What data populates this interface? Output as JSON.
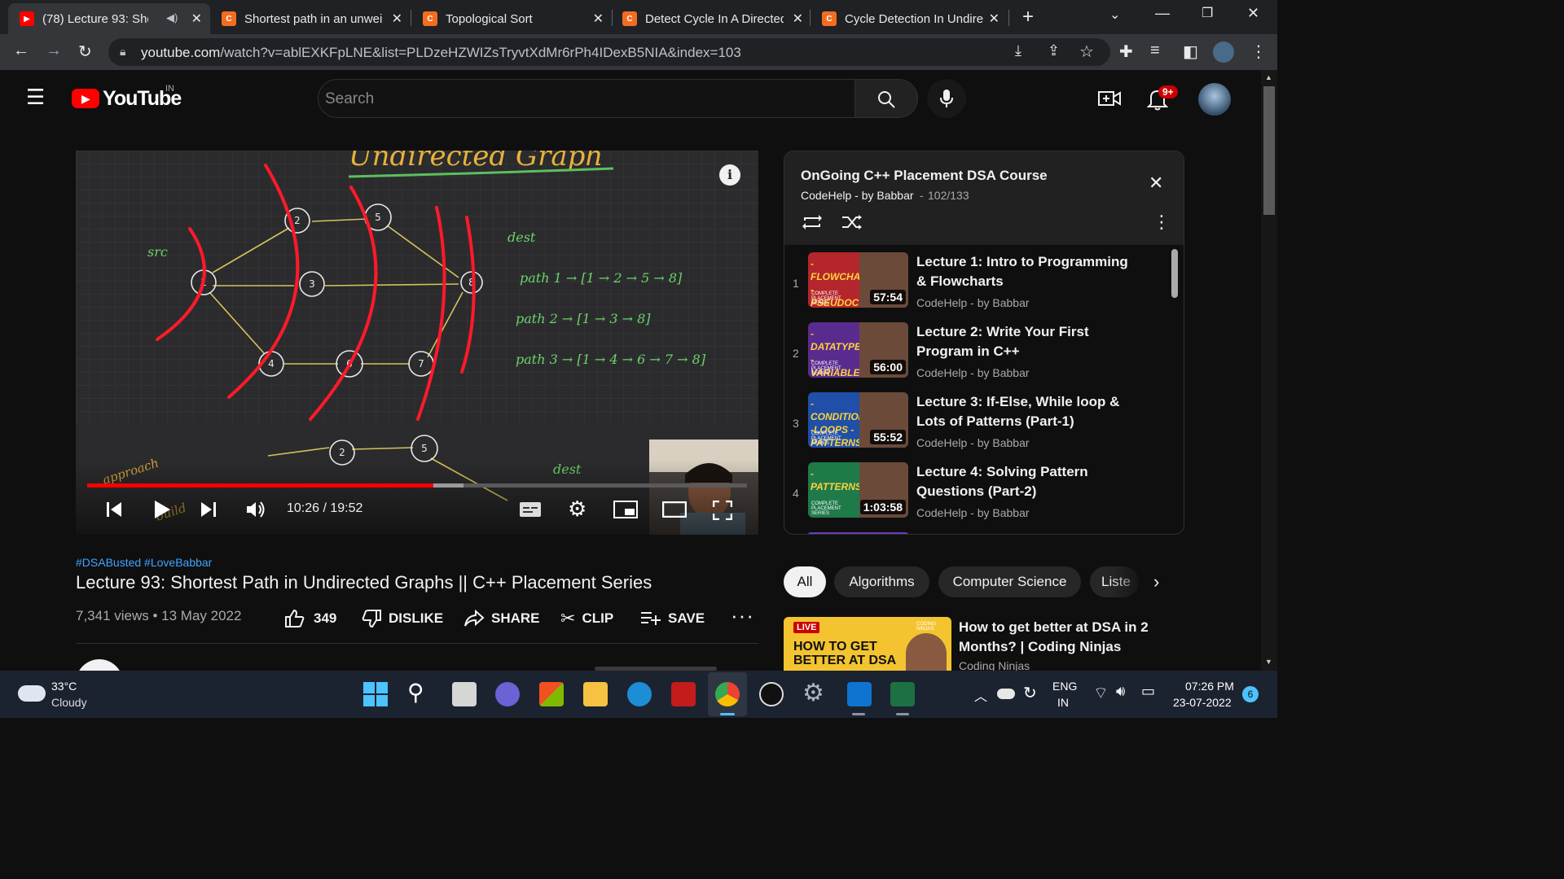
{
  "browser": {
    "tabs": [
      {
        "title": "(78) Lecture 93: Short",
        "favicon": "youtube-favicon"
      },
      {
        "title": "Shortest path in an unwei",
        "favicon": "codestudio-favicon"
      },
      {
        "title": "Topological Sort",
        "favicon": "codestudio-favicon"
      },
      {
        "title": "Detect Cycle In A Directed",
        "favicon": "codestudio-favicon"
      },
      {
        "title": "Cycle Detection In Undire",
        "favicon": "codestudio-favicon"
      }
    ],
    "url_host": "youtube.com",
    "url_rest": "/watch?v=ablEXKFpLNE&list=PLDzeHZWIZsTryvtXdMr6rPh4IDexB5NIA&index=103"
  },
  "youtube": {
    "logo_text": "YouTube",
    "region": "IN",
    "search_placeholder": "Search",
    "notification_count": "9+"
  },
  "player": {
    "time_display": "10:26 / 19:52",
    "played_fraction": 0.525,
    "loaded_fraction": 0.57,
    "board_texts": {
      "top_title": "Undirected Graph",
      "src": "src",
      "dest": "dest",
      "path1": "path 1 →  [1 → 2 → 5 → 8]",
      "path2": "path 2 →  [1 → 3 → 8]",
      "path3": "path 3 →  [1 → 4 → 6 → 7 → 8]",
      "approach": "approach",
      "build": "build",
      "node_labels": [
        "2",
        "5",
        "1",
        "3",
        "8",
        "4",
        "6",
        "7"
      ]
    }
  },
  "video": {
    "hashtags": "#DSABusted #LoveBabbar",
    "title": "Lecture 93: Shortest Path in Undirected Graphs || C++ Placement Series",
    "views_date": "7,341 views • 13 May 2022",
    "actions": {
      "like_count": "349",
      "dislike": "DISLIKE",
      "share": "SHARE",
      "clip": "CLIP",
      "save": "SAVE"
    }
  },
  "playlist": {
    "title": "OnGoing C++ Placement DSA Course",
    "channel": "CodeHelp - by Babbar",
    "position": "102/133",
    "items": [
      {
        "index": "1",
        "title": "Lecture 1: Intro to Programming & Flowcharts",
        "channel": "CodeHelp - by Babbar",
        "duration": "57:54",
        "thumb_text": "-FLOWCHART -PSEUDOCODE",
        "thumb_badge": "COMPLETE PLACEMENT SERIES",
        "color": "#b5262c"
      },
      {
        "index": "2",
        "title": "Lecture 2: Write Your First Program in C++",
        "channel": "CodeHelp - by Babbar",
        "duration": "56:00",
        "thumb_text": "-DATATYPE -VARIABLE -OPERATOR",
        "thumb_badge": "COMPLETE PLACEMENT SERIES",
        "color": "#5a2b8f"
      },
      {
        "index": "3",
        "title": "Lecture 3: If-Else, While loop & Lots of Patterns (Part-1)",
        "channel": "CodeHelp - by Babbar",
        "duration": "55:52",
        "thumb_text": "-CONDITIONALS -LOOPS -PATTERNS",
        "thumb_badge": "COMPLETE PLACEMENT SERIES",
        "color": "#1f4fa8"
      },
      {
        "index": "4",
        "title": "Lecture 4: Solving Pattern Questions (Part-2)",
        "channel": "CodeHelp - by Babbar",
        "duration": "1:03:58",
        "thumb_text": "-PATTERNS",
        "thumb_badge": "COMPLETE PLACEMENT SERIES",
        "color": "#1f7a4a"
      }
    ]
  },
  "chips": [
    "All",
    "Algorithms",
    "Computer Science",
    "Liste"
  ],
  "recommendation": {
    "live_badge": "LIVE",
    "thumb_text": "HOW TO GET BETTER AT DSA",
    "brand": "CODING NINJAS",
    "title": "How to get better at DSA in 2 Months? | Coding Ninjas",
    "channel": "Coding Ninjas"
  },
  "taskbar": {
    "temperature": "33°C",
    "weather": "Cloudy",
    "lang1": "ENG",
    "lang2": "IN",
    "time": "07:26 PM",
    "date": "23-07-2022",
    "notif_count": "6"
  }
}
